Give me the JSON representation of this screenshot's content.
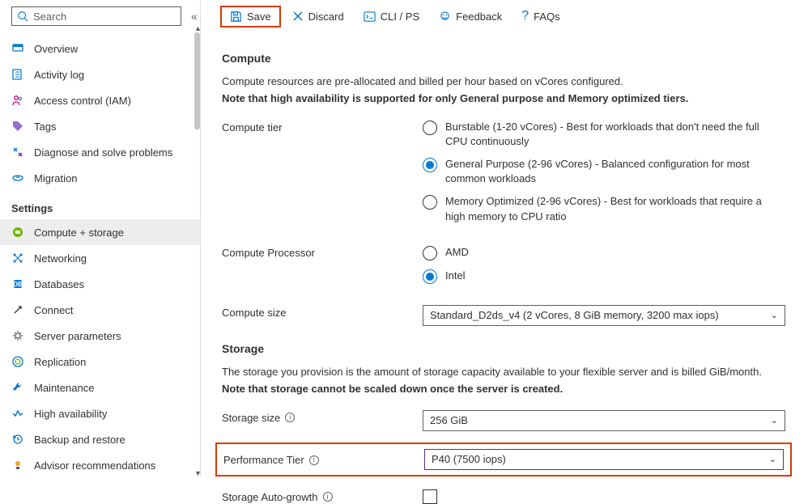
{
  "search": {
    "placeholder": "Search"
  },
  "nav": {
    "items_top": [
      {
        "label": "Overview"
      },
      {
        "label": "Activity log"
      },
      {
        "label": "Access control (IAM)"
      },
      {
        "label": "Tags"
      },
      {
        "label": "Diagnose and solve problems"
      },
      {
        "label": "Migration"
      }
    ],
    "section": "Settings",
    "items_settings": [
      {
        "label": "Compute + storage"
      },
      {
        "label": "Networking"
      },
      {
        "label": "Databases"
      },
      {
        "label": "Connect"
      },
      {
        "label": "Server parameters"
      },
      {
        "label": "Replication"
      },
      {
        "label": "Maintenance"
      },
      {
        "label": "High availability"
      },
      {
        "label": "Backup and restore"
      },
      {
        "label": "Advisor recommendations"
      }
    ]
  },
  "toolbar": {
    "save": "Save",
    "discard": "Discard",
    "cli": "CLI / PS",
    "feedback": "Feedback",
    "faqs": "FAQs"
  },
  "compute": {
    "heading": "Compute",
    "desc1": "Compute resources are pre-allocated and billed per hour based on vCores configured.",
    "desc2": "Note that high availability is supported for only General purpose and Memory optimized tiers.",
    "tier_label": "Compute tier",
    "tiers": [
      "Burstable (1-20 vCores) - Best for workloads that don't need the full CPU continuously",
      "General Purpose (2-96 vCores) - Balanced configuration for most common workloads",
      "Memory Optimized (2-96 vCores) - Best for workloads that require a high memory to CPU ratio"
    ],
    "processor_label": "Compute Processor",
    "processors": [
      "AMD",
      "Intel"
    ],
    "size_label": "Compute size",
    "size_value": "Standard_D2ds_v4 (2 vCores, 8 GiB memory, 3200 max iops)"
  },
  "storage": {
    "heading": "Storage",
    "desc1": "The storage you provision is the amount of storage capacity available to your flexible server and is billed GiB/month.",
    "desc2": "Note that storage cannot be scaled down once the server is created.",
    "size_label": "Storage size",
    "size_value": "256 GiB",
    "perf_label": "Performance Tier",
    "perf_value": "P40 (7500 iops)",
    "autogrow_label": "Storage Auto-growth"
  }
}
